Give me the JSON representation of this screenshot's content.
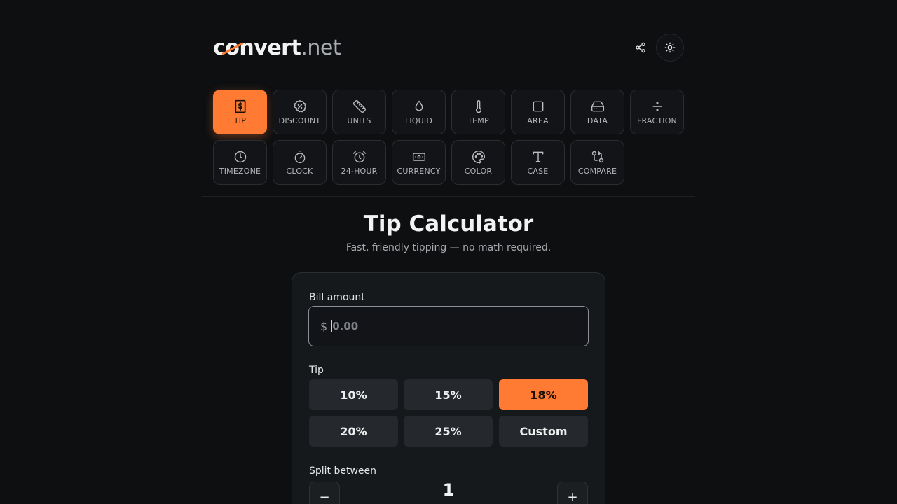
{
  "header": {
    "logo_prefix": "c",
    "logo_o": "o",
    "logo_rest": "nvert",
    "logo_tld": ".net",
    "share_icon": "share-icon",
    "theme_icon": "sun-icon"
  },
  "tools": [
    {
      "label": "TIP",
      "icon": "receipt-dollar-icon",
      "active": true
    },
    {
      "label": "DISCOUNT",
      "icon": "discount-badge-icon"
    },
    {
      "label": "UNITS",
      "icon": "ruler-icon"
    },
    {
      "label": "LIQUID",
      "icon": "droplet-icon"
    },
    {
      "label": "TEMP",
      "icon": "thermometer-icon"
    },
    {
      "label": "AREA",
      "icon": "square-icon"
    },
    {
      "label": "DATA",
      "icon": "hard-drive-icon"
    },
    {
      "label": "FRACTION",
      "icon": "divide-icon"
    },
    {
      "label": "TIMEZONE",
      "icon": "clock-icon"
    },
    {
      "label": "CLOCK",
      "icon": "stopwatch-icon"
    },
    {
      "label": "24-HOUR",
      "icon": "alarm-clock-icon"
    },
    {
      "label": "CURRENCY",
      "icon": "banknote-icon"
    },
    {
      "label": "COLOR",
      "icon": "palette-icon"
    },
    {
      "label": "CASE",
      "icon": "type-icon"
    },
    {
      "label": "COMPARE",
      "icon": "compare-arrows-icon"
    }
  ],
  "page": {
    "title": "Tip Calculator",
    "subtitle": "Fast, friendly tipping — no math required."
  },
  "form": {
    "bill_label": "Bill amount",
    "currency_symbol": "$",
    "bill_placeholder": "0.00",
    "bill_value": "",
    "tip_label": "Tip",
    "tip_options": [
      "10%",
      "15%",
      "18%",
      "20%",
      "25%",
      "Custom"
    ],
    "tip_selected": "18%",
    "split_label": "Split between",
    "split_value": "1",
    "minus_label": "−",
    "plus_label": "+"
  },
  "colors": {
    "accent": "#ff7a32",
    "background": "#0d0f11",
    "card": "#16191c"
  }
}
